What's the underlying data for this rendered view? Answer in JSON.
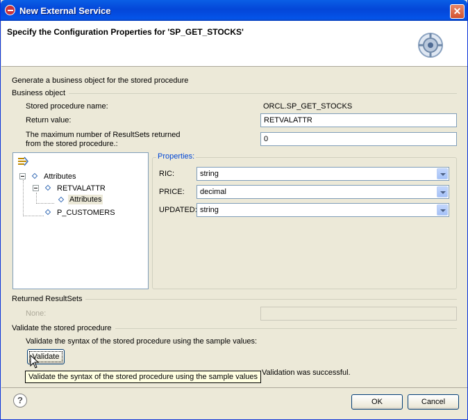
{
  "window": {
    "title": "New External Service",
    "close_glyph": "✕"
  },
  "header": {
    "title": "Specify the Configuration Properties for 'SP_GET_STOCKS'"
  },
  "intro": "Generate a business object for the stored procedure",
  "business_object": {
    "group_label": "Business object",
    "sp_name_label": "Stored procedure name:",
    "sp_name_value": "ORCL.SP_GET_STOCKS",
    "return_value_label": "Return value:",
    "return_value": "RETVALATTR",
    "max_resultsets_label_line1": "The maximum number of ResultSets returned",
    "max_resultsets_label_line2": "from the stored procedure.:",
    "max_resultsets_value": "0"
  },
  "tree": {
    "items": [
      {
        "label": "Attributes"
      },
      {
        "label": "RETVALATTR"
      },
      {
        "label": "Attributes"
      },
      {
        "label": "P_CUSTOMERS"
      }
    ]
  },
  "properties": {
    "legend": "Properties:",
    "rows": [
      {
        "label": "RIC:",
        "value": "string"
      },
      {
        "label": "PRICE:",
        "value": "decimal"
      },
      {
        "label": "UPDATED:",
        "value": "string"
      }
    ]
  },
  "returned_resultsets": {
    "group_label": "Returned ResultSets",
    "none_label": "None:",
    "value": ""
  },
  "validate": {
    "group_label": "Validate the stored procedure",
    "description": "Validate the syntax of the stored procedure using the sample values:",
    "button_label": "Validate",
    "tooltip": "Validate the syntax of the stored procedure using the sample values",
    "status": "Validation was successful."
  },
  "footer": {
    "help_glyph": "?",
    "ok_label": "OK",
    "cancel_label": "Cancel"
  },
  "colors": {
    "accent": "#0046d5",
    "titlebar": "#0454e9",
    "dialog_bg": "#ece9d8"
  }
}
